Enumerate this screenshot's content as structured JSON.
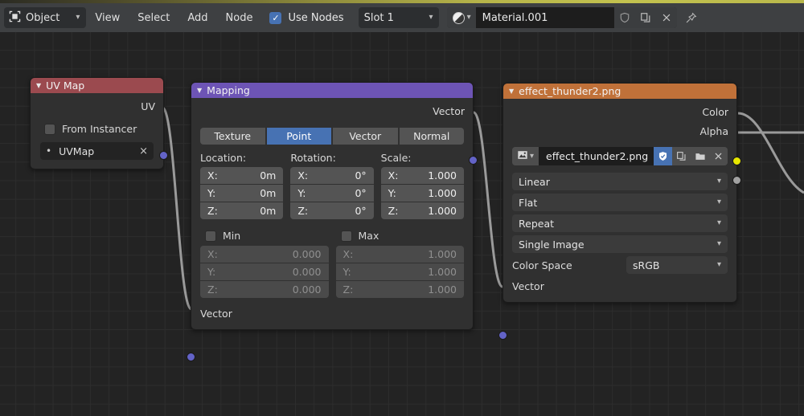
{
  "header": {
    "editor_mode": "Object",
    "editor_mode_icon": "shader-editor-icon",
    "menus": [
      "View",
      "Select",
      "Add",
      "Node"
    ],
    "use_nodes_label": "Use Nodes",
    "use_nodes_checked": true,
    "slot": "Slot 1",
    "material_name": "Material.001",
    "buttons": {
      "shield": "shield-icon",
      "copy": "duplicate-icon",
      "close": "x-icon",
      "pin": "pin-icon"
    }
  },
  "nodes": {
    "uvmap": {
      "title": "UV Map",
      "header_color": "#9b4a4f",
      "output_label": "UV",
      "from_instancer_label": "From Instancer",
      "from_instancer_checked": false,
      "uv_field_value": "UVMap",
      "uv_field_clear": "×"
    },
    "mapping": {
      "title": "Mapping",
      "header_color": "#6d54b5",
      "output_label": "Vector",
      "input_label": "Vector",
      "type_buttons": [
        "Texture",
        "Point",
        "Vector",
        "Normal"
      ],
      "type_selected": "Point",
      "location": {
        "title": "Location:",
        "axes": [
          "X:",
          "Y:",
          "Z:"
        ],
        "values": [
          "0m",
          "0m",
          "0m"
        ]
      },
      "rotation": {
        "title": "Rotation:",
        "axes": [
          "X:",
          "Y:",
          "Z:"
        ],
        "values": [
          "0°",
          "0°",
          "0°"
        ]
      },
      "scale": {
        "title": "Scale:",
        "axes": [
          "X:",
          "Y:",
          "Z:"
        ],
        "values": [
          "1.000",
          "1.000",
          "1.000"
        ]
      },
      "min": {
        "label": "Min",
        "checked": false,
        "axes": [
          "X:",
          "Y:",
          "Z:"
        ],
        "values": [
          "0.000",
          "0.000",
          "0.000"
        ]
      },
      "max": {
        "label": "Max",
        "checked": false,
        "axes": [
          "X:",
          "Y:",
          "Z:"
        ],
        "values": [
          "1.000",
          "1.000",
          "1.000"
        ]
      }
    },
    "image_texture": {
      "title": "effect_thunder2.png",
      "header_color": "#c07139",
      "outputs": [
        {
          "label": "Color",
          "socket_color": "#e6e600"
        },
        {
          "label": "Alpha",
          "socket_color": "#a1a1a1"
        }
      ],
      "image_datablock": {
        "icon": "image-icon",
        "name": "effect_thunder2.png",
        "fake_user_enabled": true,
        "buttons": [
          "shield-icon",
          "duplicate-icon",
          "folder-icon",
          "x-icon"
        ]
      },
      "interpolation": "Linear",
      "projection": "Flat",
      "extension": "Repeat",
      "source": "Single Image",
      "color_space_label": "Color Space",
      "color_space_value": "sRGB",
      "input_label": "Vector"
    }
  }
}
